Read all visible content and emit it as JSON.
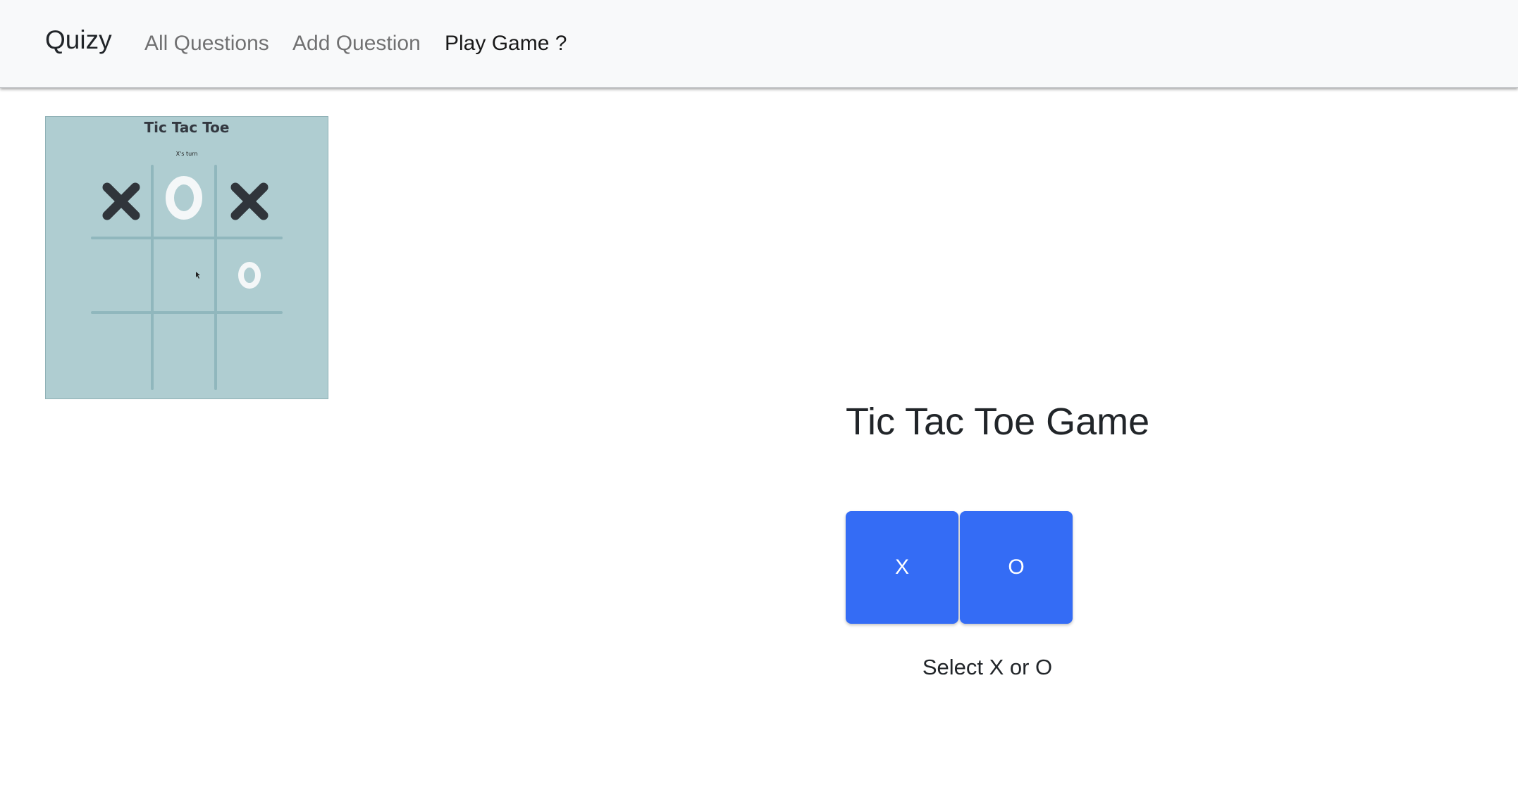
{
  "navbar": {
    "brand": "Quizy",
    "links": [
      {
        "label": "All Questions",
        "active": false
      },
      {
        "label": "Add Question",
        "active": false
      },
      {
        "label": "Play Game ?",
        "active": true
      }
    ]
  },
  "preview": {
    "title": "Tic Tac Toe",
    "turn": "X's turn",
    "board": [
      "X",
      "O",
      "X",
      "",
      "",
      "O",
      "",
      "",
      ""
    ],
    "background": "#afcdd1"
  },
  "game": {
    "title": "Tic Tac Toe Game",
    "buttons": [
      {
        "label": "X"
      },
      {
        "label": "O"
      }
    ],
    "hint": "Select X or O",
    "button_color": "#346cf5"
  }
}
